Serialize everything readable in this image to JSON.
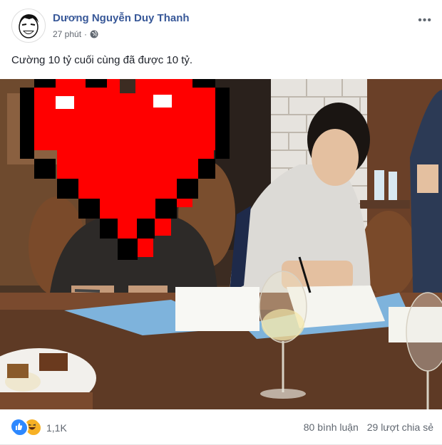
{
  "post": {
    "author": "Dương Nguyễn Duy Thanh",
    "time": "27 phút",
    "privacy_icon": "globe-icon",
    "more_icon": "more-options-icon",
    "caption": "Cường 10 tỷ cuối cùng đã được 10 tỷ."
  },
  "reactions": {
    "icons": [
      "like-icon",
      "haha-icon"
    ],
    "count": "1,1K"
  },
  "stats": {
    "comments": "80 bình luận",
    "shares": "29 lượt chia sẻ"
  },
  "colors": {
    "author": "#385898",
    "like": "#2d88ff",
    "haha": "#f7b125",
    "heart_mosaic": "#ff0000"
  }
}
